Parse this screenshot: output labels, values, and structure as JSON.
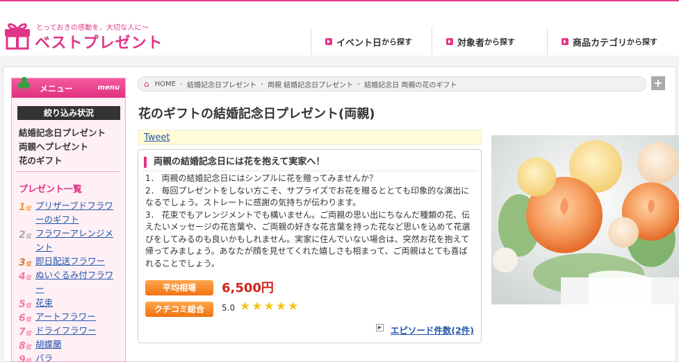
{
  "header": {
    "tagline": "とっておきの感動を、大切な人に〜",
    "brand": "ベストプレゼント",
    "nav": [
      {
        "main": "イベント日",
        "suffix": "から探す"
      },
      {
        "main": "対象者",
        "suffix": "から探す"
      },
      {
        "main": "商品カテゴリ",
        "suffix": "から探す"
      }
    ]
  },
  "sidebar": {
    "head_title": "メニュー",
    "head_sub": "menu",
    "filter_title": "絞り込み状況",
    "filters": [
      "結婚記念日プレゼント",
      "両親へプレゼント",
      "花のギフト"
    ],
    "list_title": "プレゼント一覧",
    "items": [
      {
        "rank": "1",
        "label": "プリザーブドフラワーのギフト"
      },
      {
        "rank": "2",
        "label": "フラワーアレンジメント"
      },
      {
        "rank": "3",
        "label": "即日配送フラワー"
      },
      {
        "rank": "4",
        "label": "ぬいぐるみ付フラワー"
      },
      {
        "rank": "5",
        "label": "花束"
      },
      {
        "rank": "6",
        "label": "アートフラワー"
      },
      {
        "rank": "7",
        "label": "ドライフラワー"
      },
      {
        "rank": "8",
        "label": "胡蝶蘭"
      },
      {
        "rank": "9",
        "label": "バラ"
      }
    ]
  },
  "breadcrumb": [
    "HOME",
    "結婚記念日プレゼント",
    "両親 結婚記念日プレゼント",
    "結婚記念日 両親の花のギフト"
  ],
  "page": {
    "title": "花のギフトの結婚記念日プレゼント(両親)",
    "tweet": "Tweet",
    "box_title": "両親の結婚記念日には花を抱えて実家へ！",
    "paragraphs": [
      "1． 両親の結婚記念日にはシンプルに花を贈ってみませんか？",
      "2． 毎回プレゼントをしない方こそ、サプライズでお花を贈るととても印象的な演出になるでしょう。ストレートに感謝の気持ちが伝わります。",
      "3． 花束でもアレンジメントでも構いません。ご両親の思い出にちなんだ種類の花、伝えたいメッセージの花言葉や、ご両親の好きな花言葉を持った花など思いを込めて花選びをしてみるのも良いかもしれません。実家に住んでいない場合は、突然お花を抱えて帰ってみましょう。あなたが顔を見せてくれた嬉しさも相まって、ご両親はとても喜ばれることでしょう。"
    ],
    "avg_label": "平均相場",
    "avg_price": "6,500円",
    "review_label": "クチコミ総合",
    "review_score": "5.0",
    "stars": "★★★★★",
    "episode_link": "エピソード件数(2件)"
  },
  "colors": {
    "accent": "#e03586",
    "link": "#2255aa",
    "price": "#d2241c",
    "badge": "#f0730f"
  }
}
